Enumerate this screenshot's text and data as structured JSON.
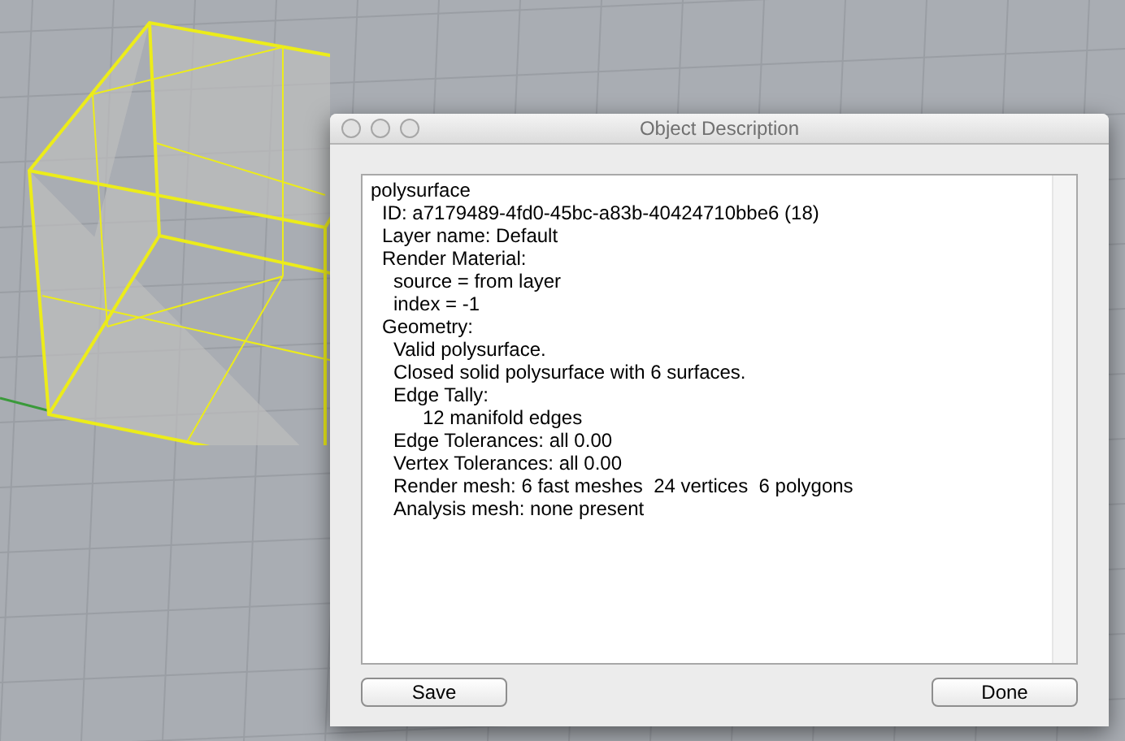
{
  "window": {
    "title": "Object Description"
  },
  "description": [
    {
      "text": "polysurface",
      "children": [
        {
          "text": "ID: a7179489-4fd0-45bc-a83b-40424710bbe6 (18)"
        },
        {
          "text": "Layer name: Default"
        },
        {
          "text": "Render Material:",
          "children": [
            {
              "text": "source = from layer"
            },
            {
              "text": "index = -1"
            }
          ]
        },
        {
          "text": "Geometry:",
          "children": [
            {
              "text": "Valid polysurface."
            },
            {
              "text": "Closed solid polysurface with 6 surfaces."
            },
            {
              "text": "Edge Tally:",
              "children": [
                {
                  "text": "12 manifold edges"
                }
              ]
            },
            {
              "text": "Edge Tolerances: all 0.00"
            },
            {
              "text": "Vertex Tolerances: all 0.00"
            },
            {
              "text": "Render mesh: 6 fast meshes  24 vertices  6 polygons"
            },
            {
              "text": "Analysis mesh: none present"
            }
          ]
        }
      ]
    }
  ],
  "buttons": [
    {
      "label": "Save"
    },
    {
      "label": "Done"
    }
  ]
}
